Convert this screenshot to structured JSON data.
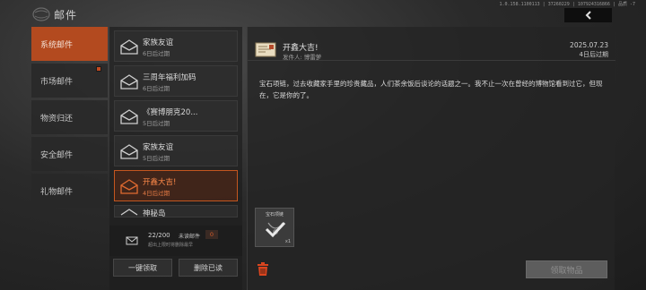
{
  "window": {
    "title": "邮件",
    "version_text": "1.0.158.1100113 | 37260229 | 107924316866 | 品质 -7",
    "back_icon": "chevron-left-icon"
  },
  "sidebar": {
    "items": [
      {
        "label": "系统邮件",
        "active": true,
        "has_dot": false
      },
      {
        "label": "市场邮件",
        "active": false,
        "has_dot": true
      },
      {
        "label": "物资归还",
        "active": false,
        "has_dot": false
      },
      {
        "label": "安全邮件",
        "active": false,
        "has_dot": false
      },
      {
        "label": "礼物邮件",
        "active": false,
        "has_dot": false
      }
    ]
  },
  "mail_list": {
    "items": [
      {
        "title": "家族友谊",
        "expiry": "6日后过期"
      },
      {
        "title": "三周年福利加码",
        "expiry": "6日后过期"
      },
      {
        "title": "《赛博朋克20...",
        "expiry": "5日后过期"
      },
      {
        "title": "家族友谊",
        "expiry": "5日后过期"
      },
      {
        "title": "开鑫大吉!",
        "expiry": "4日后过期"
      },
      {
        "title": "神秘岛",
        "expiry": ""
      }
    ],
    "count_text": "22/200",
    "unread_label": "未读邮件",
    "unread_count": "0",
    "hint": "超出上限时将删除最早",
    "claim_all_label": "一键领取",
    "delete_read_label": "删除已读"
  },
  "detail": {
    "title": "开鑫大吉!",
    "sender_label": "发件人:",
    "sender": "博雷萝",
    "date": "2025.07.23",
    "expiry": "4日后过期",
    "body": "宝石项链，过去收藏家手里的珍贵藏品，人们茶余饭后谈论的话题之一。我不止一次在曾经的博物馆看到过它，但现在，它是你的了。",
    "attachment": {
      "label": "宝石项链",
      "qty": "x1",
      "icon": "necklace-icon"
    },
    "claim_label": "领取物品",
    "accent": "#c24a20"
  }
}
